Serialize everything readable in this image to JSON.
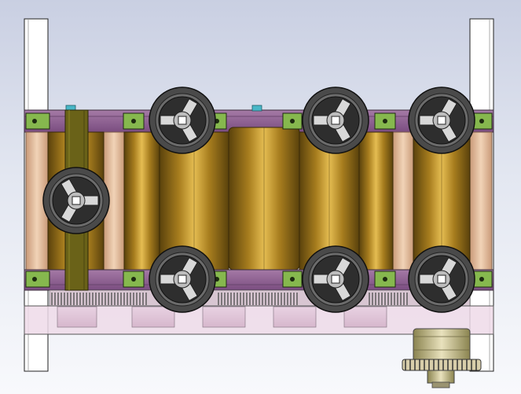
{
  "view": {
    "background_top": "#c9cfe2",
    "background_bottom": "#f8f9fc",
    "rendering": "shaded-with-edges"
  },
  "model": {
    "frame_color": "#ffffff",
    "plate_color": "#8a5a8e",
    "roller_colors": [
      "#6e5210",
      "#c79a2a",
      "#f0cc62"
    ],
    "bracket_color": "#86b84e",
    "bracket_dark_color": "#1d2a10",
    "handwheel_color": "#3a3a3a",
    "handwheel_count": 7,
    "roller_count": 6,
    "bracket_count": 12,
    "tab_color": "#49b7c7",
    "base_color": "#ecd4e4",
    "gear_color": "#d8ceaa",
    "belt_color": "#6a6218",
    "motor_color": "#b6ad7a"
  }
}
